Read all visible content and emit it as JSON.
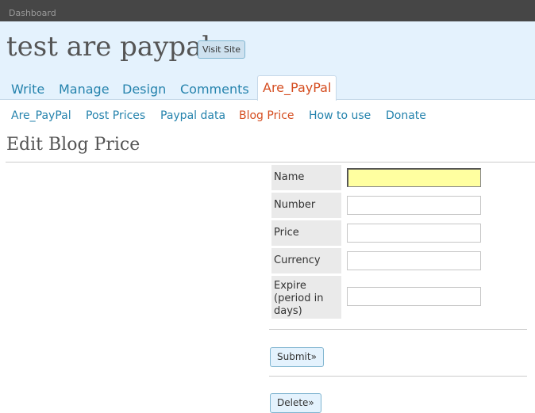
{
  "topbar": {
    "dashboard_label": "Dashboard"
  },
  "header": {
    "site_title": "test are paypal",
    "visit_site_label": "Visit Site",
    "tabs": [
      {
        "label": "Write"
      },
      {
        "label": "Manage"
      },
      {
        "label": "Design"
      },
      {
        "label": "Comments"
      },
      {
        "label": "Are_PayPal",
        "active": true
      }
    ]
  },
  "subnav": {
    "items": [
      {
        "label": "Are_PayPal"
      },
      {
        "label": "Post Prices"
      },
      {
        "label": "Paypal data"
      },
      {
        "label": "Blog Price",
        "active": true
      },
      {
        "label": "How to use"
      },
      {
        "label": "Donate"
      }
    ]
  },
  "page": {
    "title": "Edit Blog Price"
  },
  "form": {
    "fields": [
      {
        "label": "Name",
        "value": ""
      },
      {
        "label": "Number",
        "value": ""
      },
      {
        "label": "Price",
        "value": ""
      },
      {
        "label": "Currency",
        "value": ""
      },
      {
        "label": "Expire (period in days)",
        "value": ""
      }
    ],
    "submit_label": "Submit»",
    "delete_label": "Delete»"
  },
  "colors": {
    "topbar": "#464646",
    "header_bg": "#e4f2fd",
    "link": "#2583ad",
    "active": "#d54e21",
    "focused_input": "#ffffa0"
  }
}
